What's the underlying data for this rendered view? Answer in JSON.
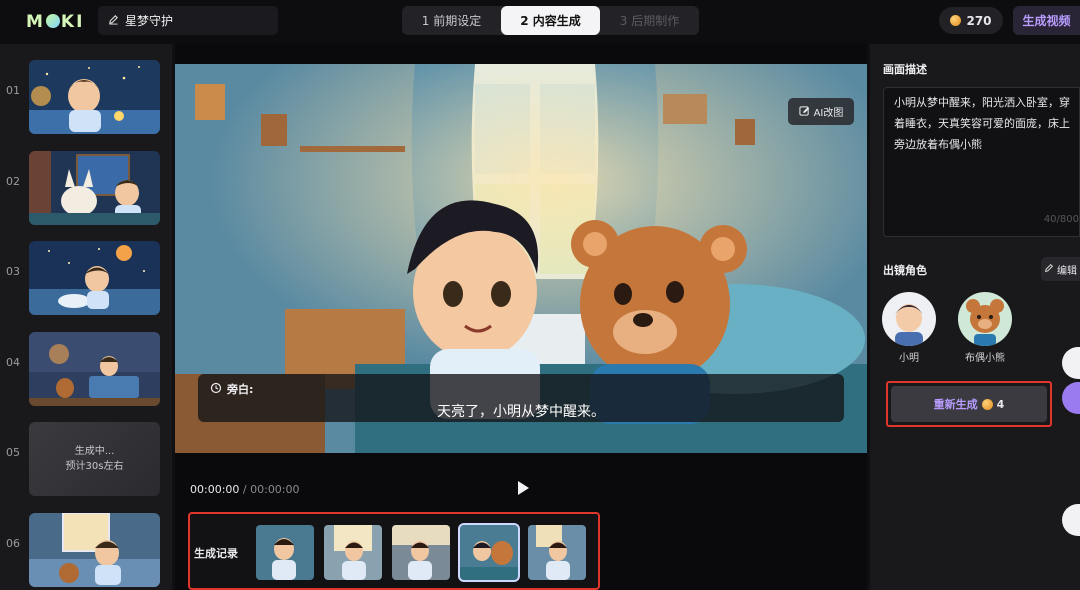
{
  "topbar": {
    "logo": "MOKI",
    "project_title": "星梦守护",
    "steps": [
      {
        "label": "1 前期设定",
        "state": "done"
      },
      {
        "label": "2 内容生成",
        "state": "active"
      },
      {
        "label": "3 后期制作",
        "state": "disabled"
      }
    ],
    "coins": "270",
    "generate_video_label": "生成视频"
  },
  "scenes": [
    {
      "num": "01",
      "status": "done"
    },
    {
      "num": "02",
      "status": "done"
    },
    {
      "num": "03",
      "status": "done"
    },
    {
      "num": "04",
      "status": "done"
    },
    {
      "num": "05",
      "status": "generating",
      "line1": "生成中...",
      "line2": "预计30s左右"
    },
    {
      "num": "06",
      "status": "done"
    }
  ],
  "preview": {
    "ai_edit_label": "AI改图",
    "narration_label": "旁白:",
    "narration_text": "天亮了，小明从梦中醒来。",
    "time_current": "00:00:00",
    "time_separator": " / ",
    "time_total": "00:00:00"
  },
  "history": {
    "label": "生成记录",
    "items": 5,
    "selected_index": 3
  },
  "right_panel": {
    "description_title": "画面描述",
    "description_text": "小明从梦中醒来，阳光洒入卧室，穿着睡衣，天真笑容可爱的面庞，床上旁边放着布偶小熊",
    "description_count": "40/800",
    "cast_title": "出镜角色",
    "edit_label": "编辑",
    "characters": [
      {
        "name": "小明"
      },
      {
        "name": "布偶小熊"
      }
    ],
    "regenerate_label": "重新生成",
    "regenerate_cost": "4"
  },
  "colors": {
    "accent_purple": "#b89cff",
    "highlight_red": "#e0352b",
    "coin_gold": "#f0a43a"
  }
}
